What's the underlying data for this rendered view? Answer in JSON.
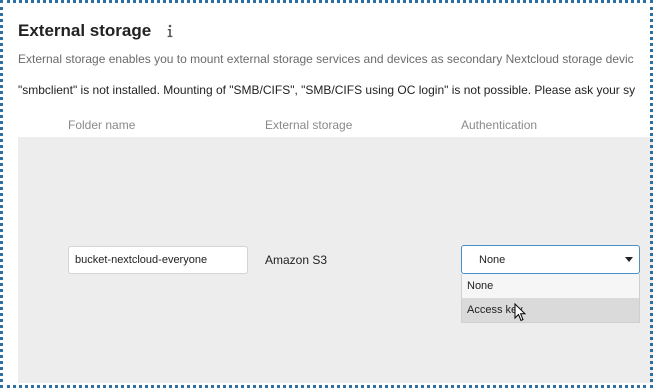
{
  "section": {
    "title": "External storage",
    "info_glyph": "i",
    "description": "External storage enables you to mount external storage services and devices as secondary Nextcloud storage devic",
    "warning": "\"smbclient\" is not installed. Mounting of \"SMB/CIFS\", \"SMB/CIFS using OC login\" is not possible. Please ask your sy"
  },
  "table": {
    "headers": {
      "folder": "Folder name",
      "storage": "External storage",
      "auth": "Authentication"
    },
    "row": {
      "folder_value": "bucket-nextcloud-everyone",
      "storage": "Amazon S3",
      "auth_selected": "None"
    }
  },
  "dropdown": {
    "options": [
      "None",
      "Access key"
    ],
    "hovered_index": 1
  },
  "icons": {
    "info": "info-icon",
    "caret": "caret-down-icon",
    "cursor": "mouse-pointer-icon"
  },
  "colors": {
    "frame": "#2d6fa3",
    "select_border": "#4a90c8",
    "row_background": "#ededed"
  }
}
